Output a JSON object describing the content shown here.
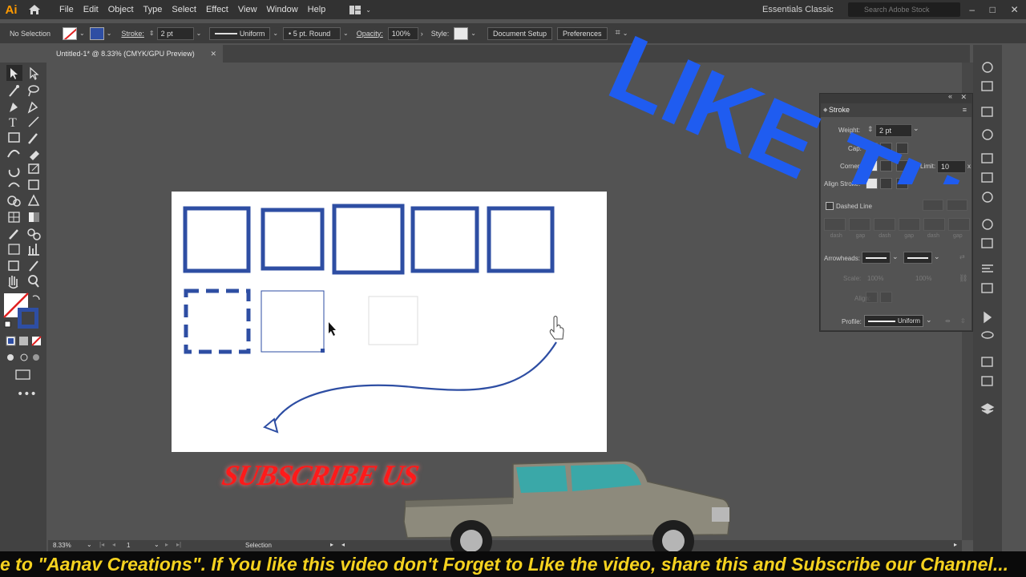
{
  "app": {
    "logo": "Ai"
  },
  "menu": [
    "File",
    "Edit",
    "Object",
    "Type",
    "Select",
    "Effect",
    "View",
    "Window",
    "Help"
  ],
  "workspace": "Essentials Classic",
  "search": {
    "placeholder": "Search Adobe Stock"
  },
  "control": {
    "selection": "No Selection",
    "stroke_label": "Stroke:",
    "stroke_weight": "2 pt",
    "profile": "Uniform",
    "brush": "5 pt. Round",
    "opacity_label": "Opacity:",
    "opacity": "100%",
    "style_label": "Style:",
    "doc_setup": "Document Setup",
    "preferences": "Preferences"
  },
  "document": {
    "tab_title": "Untitled-1* @ 8.33% (CMYK/GPU Preview)"
  },
  "stroke_panel": {
    "title": "Stroke",
    "weight_label": "Weight:",
    "weight": "2 pt",
    "cap_label": "Cap:",
    "corner_label": "Corner:",
    "limit_label": "Limit:",
    "limit": "10",
    "limit_unit": "x",
    "align_label": "Align Stroke:",
    "dashed_label": "Dashed Line",
    "dash_labels": [
      "dash",
      "gap",
      "dash",
      "gap",
      "dash",
      "gap"
    ],
    "arrowheads_label": "Arrowheads:",
    "scale_label": "Scale:",
    "scale_a": "100%",
    "scale_b": "100%",
    "align_arrow_label": "Align:",
    "profile_label": "Profile:",
    "profile": "Uniform"
  },
  "status": {
    "zoom": "8.33%",
    "artboard": "1",
    "tool": "Selection"
  },
  "overlay": {
    "like_text": "LIKE TH",
    "subscribe": "SUBSCRIBE US",
    "ticker": "e to \"Aanav Creations\". If You like this video don't Forget to Like the video, share this and Subscribe our Channel..."
  },
  "colors": {
    "accent_blue": "#2e4ea3",
    "like_blue": "#1f5cf0",
    "ticker_yellow": "#f5d21f",
    "subscribe_red": "#ff1a1a"
  }
}
